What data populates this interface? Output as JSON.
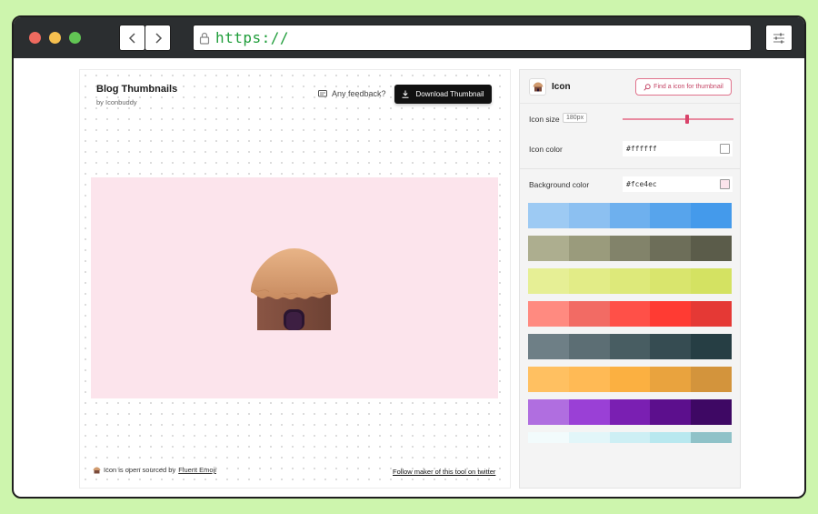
{
  "browser": {
    "url": "https://"
  },
  "editor": {
    "title": "Blog Thumbnails",
    "subtitle": "by Iconbuddy",
    "feedback_label": "Any feedback?",
    "download_label": "Download Thumbnail",
    "canvas_bg": "#fce4ec",
    "footnote_prefix": "Icon is open sourced by",
    "footnote_link": "Fluent Emoji",
    "follow_label": "Follow maker of this tool on twitter"
  },
  "panel": {
    "header_title": "Icon",
    "find_icon_label": "Find a icon for thumbnail",
    "icon_size_label": "Icon size",
    "icon_size_value": "180px",
    "icon_size_fraction": 0.58,
    "icon_color_label": "Icon color",
    "icon_color_value": "#ffffff",
    "bg_color_label": "Background color",
    "bg_color_value": "#fce4ec"
  },
  "palettes": [
    [
      "#9dcaf3",
      "#8cc0f1",
      "#6eb0ee",
      "#57a4ec",
      "#449aeb"
    ],
    [
      "#adae8f",
      "#9a9b7c",
      "#82836a",
      "#6d6e59",
      "#5b5c4a"
    ],
    [
      "#e6ef95",
      "#e2ec87",
      "#dde97a",
      "#d9e56d",
      "#d4e262"
    ],
    [
      "#ff8a80",
      "#f26b64",
      "#ff5048",
      "#ff3b33",
      "#e53935"
    ],
    [
      "#6e7f86",
      "#5c6e74",
      "#485d62",
      "#364c52",
      "#263e44"
    ],
    [
      "#ffc061",
      "#ffba55",
      "#fbb041",
      "#e9a33e",
      "#d3943c"
    ],
    [
      "#b06ee0",
      "#9a40d6",
      "#7a1fb2",
      "#5c0f8d",
      "#3e0864"
    ],
    [
      "#f2fbfc",
      "#e2f6f9",
      "#cdeff4",
      "#b8e8ef",
      "#8fc2c8"
    ]
  ],
  "colors": {
    "accent": "#d9436a",
    "download_bg": "#111111"
  }
}
